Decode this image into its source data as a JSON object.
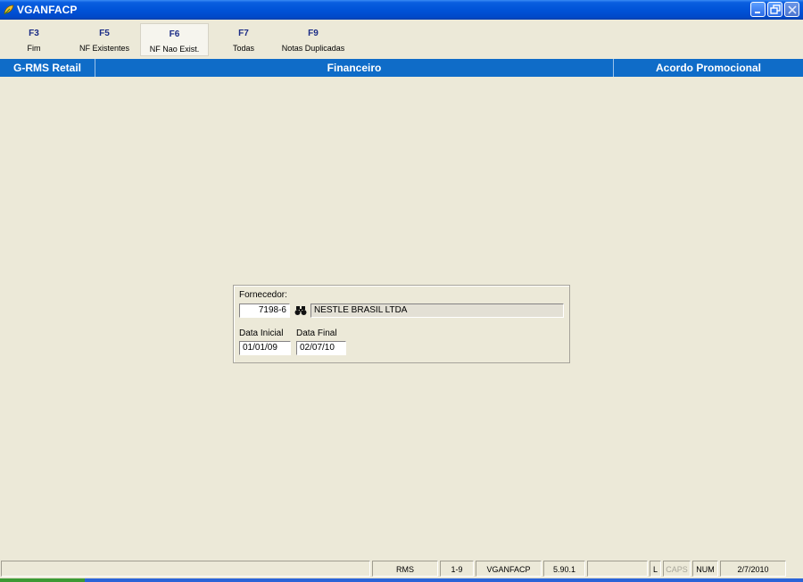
{
  "window": {
    "title": "VGANFACP",
    "app_icon": "rms-leaf-icon",
    "buttons": [
      "minimize-icon",
      "restore-icon",
      "close-icon"
    ]
  },
  "function_keys": [
    {
      "key": "F3",
      "label": "Fim"
    },
    {
      "key": "F5",
      "label": "NF Existentes"
    },
    {
      "key": "F6",
      "label": "NF Nao Exist."
    },
    {
      "key": "F7",
      "label": "Todas"
    },
    {
      "key": "F9",
      "label": "Notas Duplicadas"
    }
  ],
  "header": {
    "left": "G-RMS Retail",
    "center": "Financeiro",
    "right": "Acordo Promocional"
  },
  "form": {
    "supplier_label": "Fornecedor:",
    "supplier_code": "7198-6",
    "supplier_name": "NESTLE BRASIL LTDA",
    "start_date_label": "Data Inicial",
    "start_date": "01/01/09",
    "end_date_label": "Data Final",
    "end_date": "02/07/10",
    "lookup_icon": "binoculars-icon"
  },
  "status_bar": {
    "system": "RMS",
    "page": "1-9",
    "program": "VGANFACP",
    "version": "5.90.1",
    "lock": "L",
    "caps": "CAPS",
    "num": "NUM",
    "date": "2/7/2010"
  },
  "colors": {
    "header_band": "#0f6cc8",
    "title_bar": "#0053d8",
    "background": "#ece9d8",
    "fkey_text": "#1b2c86"
  }
}
